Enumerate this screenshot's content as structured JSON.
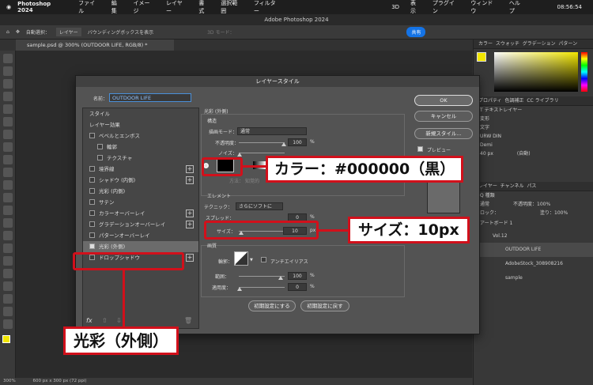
{
  "menubar": {
    "app": "Photoshop 2024",
    "items": [
      "ファイル",
      "編集",
      "イメージ",
      "レイヤー",
      "書式",
      "選択範囲",
      "フィルター",
      "3D",
      "表示",
      "プラグイン",
      "ウィンドウ",
      "ヘルプ"
    ],
    "clock": "08:56:54"
  },
  "window": {
    "title": "Adobe Photoshop 2024"
  },
  "options": {
    "auto_select": "自動選択：",
    "layer_select": "レイヤー",
    "bounding_box": "バウンディングボックスを表示",
    "mode3d": "3D モード：",
    "share": "共有"
  },
  "doc_tab": "sample.psd @ 300% (OUTDOOR LIFE, RGB/8) *",
  "status": {
    "zoom": "300%",
    "size": "600 px x 300 px (72 ppi)"
  },
  "dialog": {
    "title": "レイヤースタイル",
    "name_label": "名前：",
    "name_value": "OUTDOOR LIFE",
    "styles_header": "スタイル",
    "effects_header": "レイヤー効果",
    "items": [
      {
        "label": "ベベルとエンボス",
        "checked": false,
        "plus": false
      },
      {
        "label": "輪郭",
        "checked": false,
        "plus": false
      },
      {
        "label": "テクスチャ",
        "checked": false,
        "plus": false
      },
      {
        "label": "境界線",
        "checked": false,
        "plus": true
      },
      {
        "label": "シャドウ (内側)",
        "checked": false,
        "plus": true
      },
      {
        "label": "光彩 (内側)",
        "checked": false,
        "plus": false
      },
      {
        "label": "サテン",
        "checked": false,
        "plus": false
      },
      {
        "label": "カラーオーバーレイ",
        "checked": false,
        "plus": true
      },
      {
        "label": "グラデーションオーバーレイ",
        "checked": false,
        "plus": true
      },
      {
        "label": "パターンオーバーレイ",
        "checked": false,
        "plus": false
      },
      {
        "label": "光彩 (外側)",
        "checked": true,
        "plus": false
      },
      {
        "label": "ドロップシャドウ",
        "checked": false,
        "plus": true
      }
    ],
    "fx_label": "fx",
    "section_title": "光彩 (外側)",
    "structure": "構造",
    "blend_label": "描画モード：",
    "blend_value": "通常",
    "opacity_label": "不透明度：",
    "opacity_value": "100",
    "noise_label": "ノイズ：",
    "method_label": "方法：",
    "method_value": "知覚的",
    "element": "エレメント",
    "technique_label": "テクニック：",
    "technique_value": "さらにソフトに",
    "spread_label": "スプレッド：",
    "spread_value": "0",
    "size_label": "サイズ：",
    "size_value": "10",
    "px": "px",
    "pct": "%",
    "quality": "画質",
    "contour_label": "輪郭：",
    "antialias": "アンチエイリアス",
    "range_label": "範囲：",
    "range_value": "100",
    "jitter_label": "適用度：",
    "jitter_value": "0",
    "reset_default": "初期設定にする",
    "restore_default": "初期設定に戻す",
    "ok": "OK",
    "cancel": "キャンセル",
    "new_style": "新規スタイル...",
    "preview": "プレビュー",
    "glow_color": "#000000"
  },
  "panel": {
    "color_tabs": [
      "カラー",
      "スウォッチ",
      "グラデーション",
      "パターン"
    ],
    "prop_tabs": [
      "プロパティ",
      "色調補正",
      "CC ライブラリ"
    ],
    "text_layer": "テキストレイヤー",
    "transform": "変形",
    "char": "文字",
    "font": "URW DIN",
    "weight": "Demi",
    "size": "40 px",
    "leading": "(自動)",
    "layer_tabs": [
      "レイヤー",
      "チャンネル",
      "パス"
    ],
    "kind": "Q 種類",
    "blend": "通常",
    "opacity_label": "不透明度：",
    "opacity": "100%",
    "lock": "ロック：",
    "fill_label": "塗り：",
    "fill": "100%",
    "layers": [
      "アートボード 1",
      "Vol.12",
      "OUTDOOR LIFE",
      "AdobeStock_308908216",
      "sample"
    ]
  },
  "annotations": {
    "color": "カラー：#000000（黒）",
    "size": "サイズ：10px",
    "outer_glow": "光彩（外側）"
  },
  "colors": {
    "accent_red": "#d1101b",
    "fg_swatch": "#f2e600"
  }
}
